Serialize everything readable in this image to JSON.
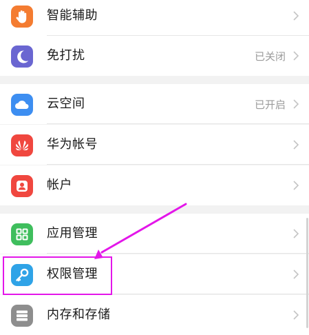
{
  "settings_items": [
    {
      "id": "smart-assist",
      "label": "智能辅助",
      "value": "",
      "icon": "hand-icon",
      "icon_color": "#f47c31"
    },
    {
      "id": "do-not-disturb",
      "label": "免打扰",
      "value": "已关闭",
      "icon": "moon-icon",
      "icon_color": "#6a66d1"
    },
    {
      "id": "cloud-space",
      "label": "云空间",
      "value": "已开启",
      "icon": "cloud-icon",
      "icon_color": "#3d8ef1"
    },
    {
      "id": "huawei-account",
      "label": "华为帐号",
      "value": "",
      "icon": "huawei-logo-icon",
      "icon_color": "#f0473f"
    },
    {
      "id": "accounts",
      "label": "帐户",
      "value": "",
      "icon": "person-icon",
      "icon_color": "#f0473f"
    },
    {
      "id": "app-management",
      "label": "应用管理",
      "value": "",
      "icon": "apps-grid-icon",
      "icon_color": "#3fbe5d"
    },
    {
      "id": "permission-management",
      "label": "权限管理",
      "value": "",
      "icon": "key-icon",
      "icon_color": "#2fa3e7"
    },
    {
      "id": "storage",
      "label": "内存和存储",
      "value": "",
      "icon": "storage-icon",
      "icon_color": "#8e8e8e"
    }
  ],
  "annotation": {
    "highlight_color": "#e316e9",
    "highlighted_item": "permission-management"
  },
  "colors": {
    "background": "#f2f2f2",
    "row_background": "#ffffff",
    "secondary_text": "#9a9a9a",
    "chevron": "#c4c4c4"
  }
}
